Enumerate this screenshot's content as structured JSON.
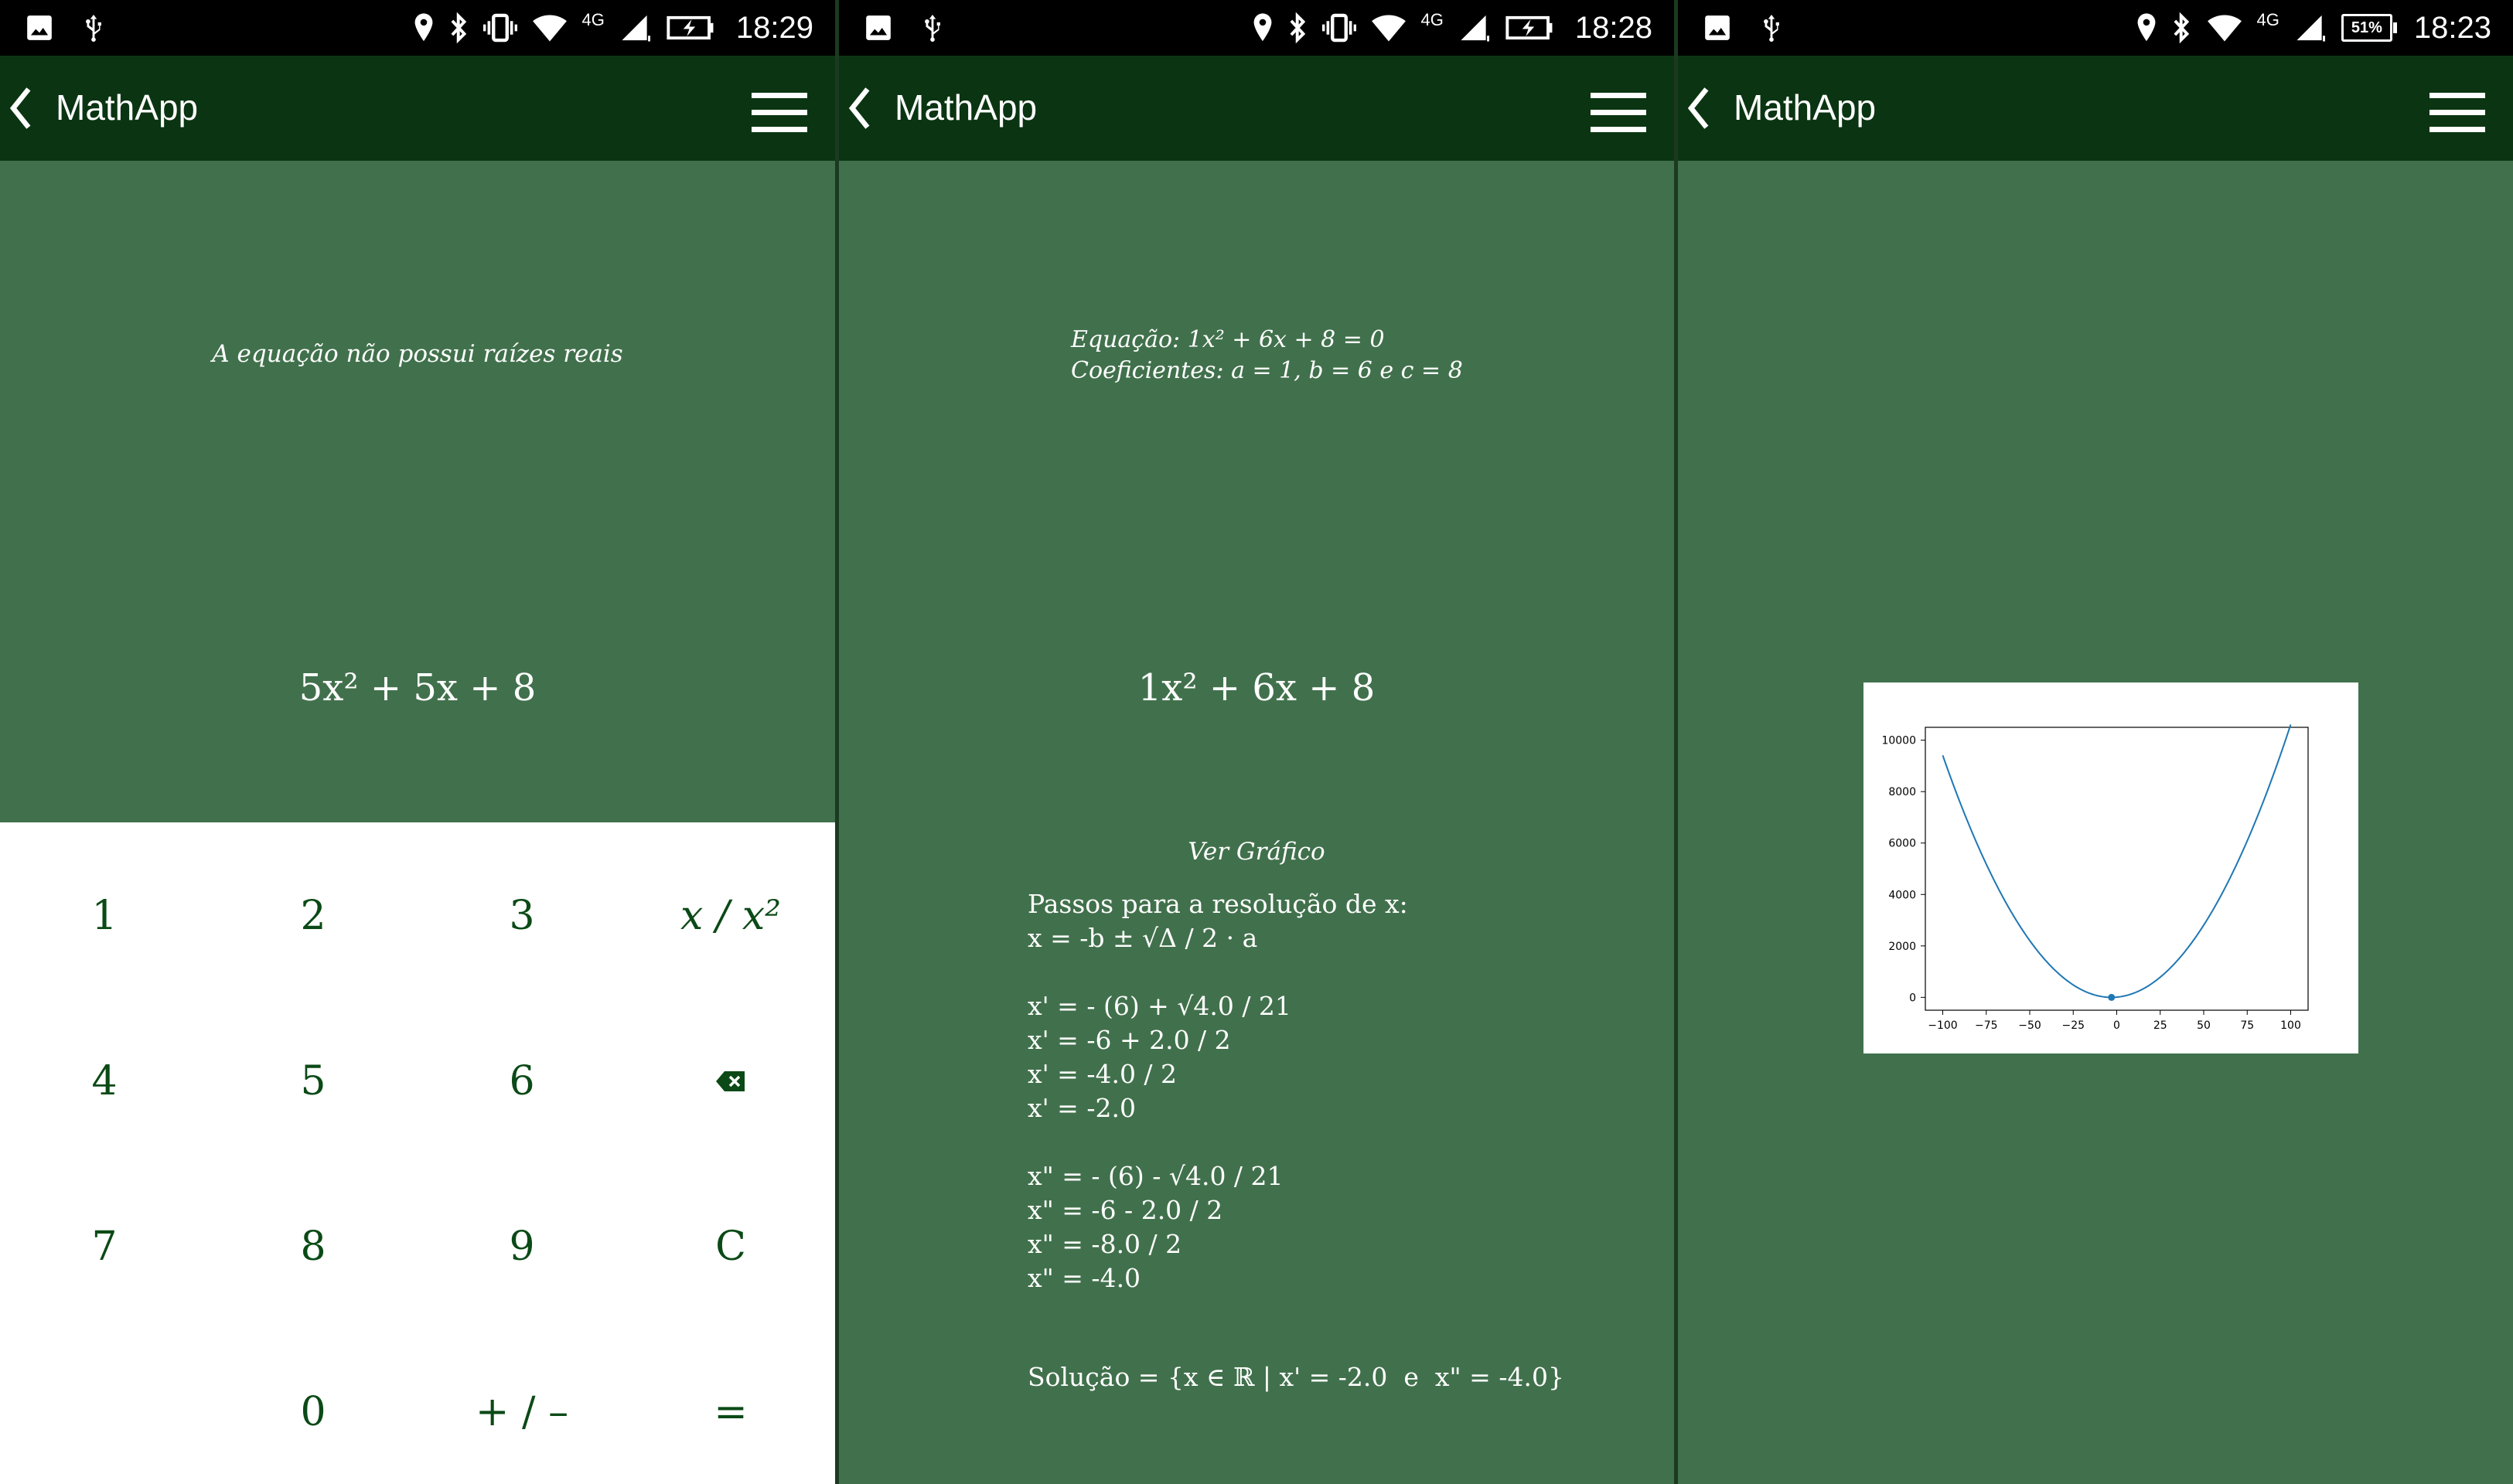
{
  "screens": [
    {
      "status": {
        "time": "18:29",
        "network": "4G",
        "battery_label": ""
      },
      "app_title": "MathApp",
      "message": "A equação não possui raízes reais",
      "equation": "5x² + 5x + 8",
      "keypad": {
        "k1": "1",
        "k2": "2",
        "k3": "3",
        "kpow": "x / x²",
        "k4": "4",
        "k5": "5",
        "k6": "6",
        "kback": "backspace-icon",
        "k7": "7",
        "k8": "8",
        "k9": "9",
        "kclear": "C",
        "k0": "0",
        "ksign": "+ / –",
        "keq": "="
      }
    },
    {
      "status": {
        "time": "18:28",
        "network": "4G",
        "battery_label": ""
      },
      "app_title": "MathApp",
      "equation_label": "Equação: 1x² + 6x + 8 = 0",
      "coefficients_label": "Coeficientes: a = 1, b = 6  e  c = 8",
      "equation": "1x² + 6x + 8",
      "graph_link": "Ver Gráfico",
      "steps": [
        "Passos para a resolução de x:",
        "x = -b ± √Δ / 2 · a",
        "",
        "x' = - (6) + √4.0 / 21",
        "x' = -6 + 2.0 / 2",
        "x' = -4.0 / 2",
        "x' = -2.0",
        "",
        "x\" = - (6) - √4.0 / 21",
        "x\" = -6 - 2.0 / 2",
        "x\" = -8.0 / 2",
        "x\" = -4.0"
      ],
      "solution": "Solução = {x ∈ ℝ | x' = -2.0  e  x\" = -4.0}"
    },
    {
      "status": {
        "time": "18:23",
        "network": "4G",
        "battery_label": "51%"
      },
      "app_title": "MathApp"
    }
  ],
  "colors": {
    "app_bar": "#0b3512",
    "content_bg": "#41714c",
    "key_text": "#0b4a16",
    "plot_line": "#1f77b4"
  },
  "chart_data": {
    "type": "line",
    "title": "",
    "xlabel": "",
    "ylabel": "",
    "xlim": [
      -110,
      110
    ],
    "ylim": [
      -500,
      10500
    ],
    "x_ticks": [
      -100,
      -75,
      -50,
      -25,
      0,
      25,
      50,
      75,
      100
    ],
    "y_ticks": [
      0,
      2000,
      4000,
      6000,
      8000,
      10000
    ],
    "x_tick_labels": [
      "−100",
      "−75",
      "−50",
      "−25",
      "0",
      "25",
      "50",
      "75",
      "100"
    ],
    "y_tick_labels": [
      "0",
      "2000",
      "4000",
      "6000",
      "8000",
      "10000"
    ],
    "series": [
      {
        "function": "x^2 + 6x + 8",
        "x_range": [
          -100,
          100
        ],
        "sample_points": [
          [
            -100,
            9408
          ],
          [
            -75,
            5183
          ],
          [
            -50,
            2208
          ],
          [
            -25,
            483
          ],
          [
            0,
            8
          ],
          [
            25,
            783
          ],
          [
            50,
            2808
          ],
          [
            75,
            6083
          ],
          [
            100,
            10608
          ]
        ]
      }
    ],
    "marked_point": [
      -3,
      -1
    ],
    "grid": false
  }
}
